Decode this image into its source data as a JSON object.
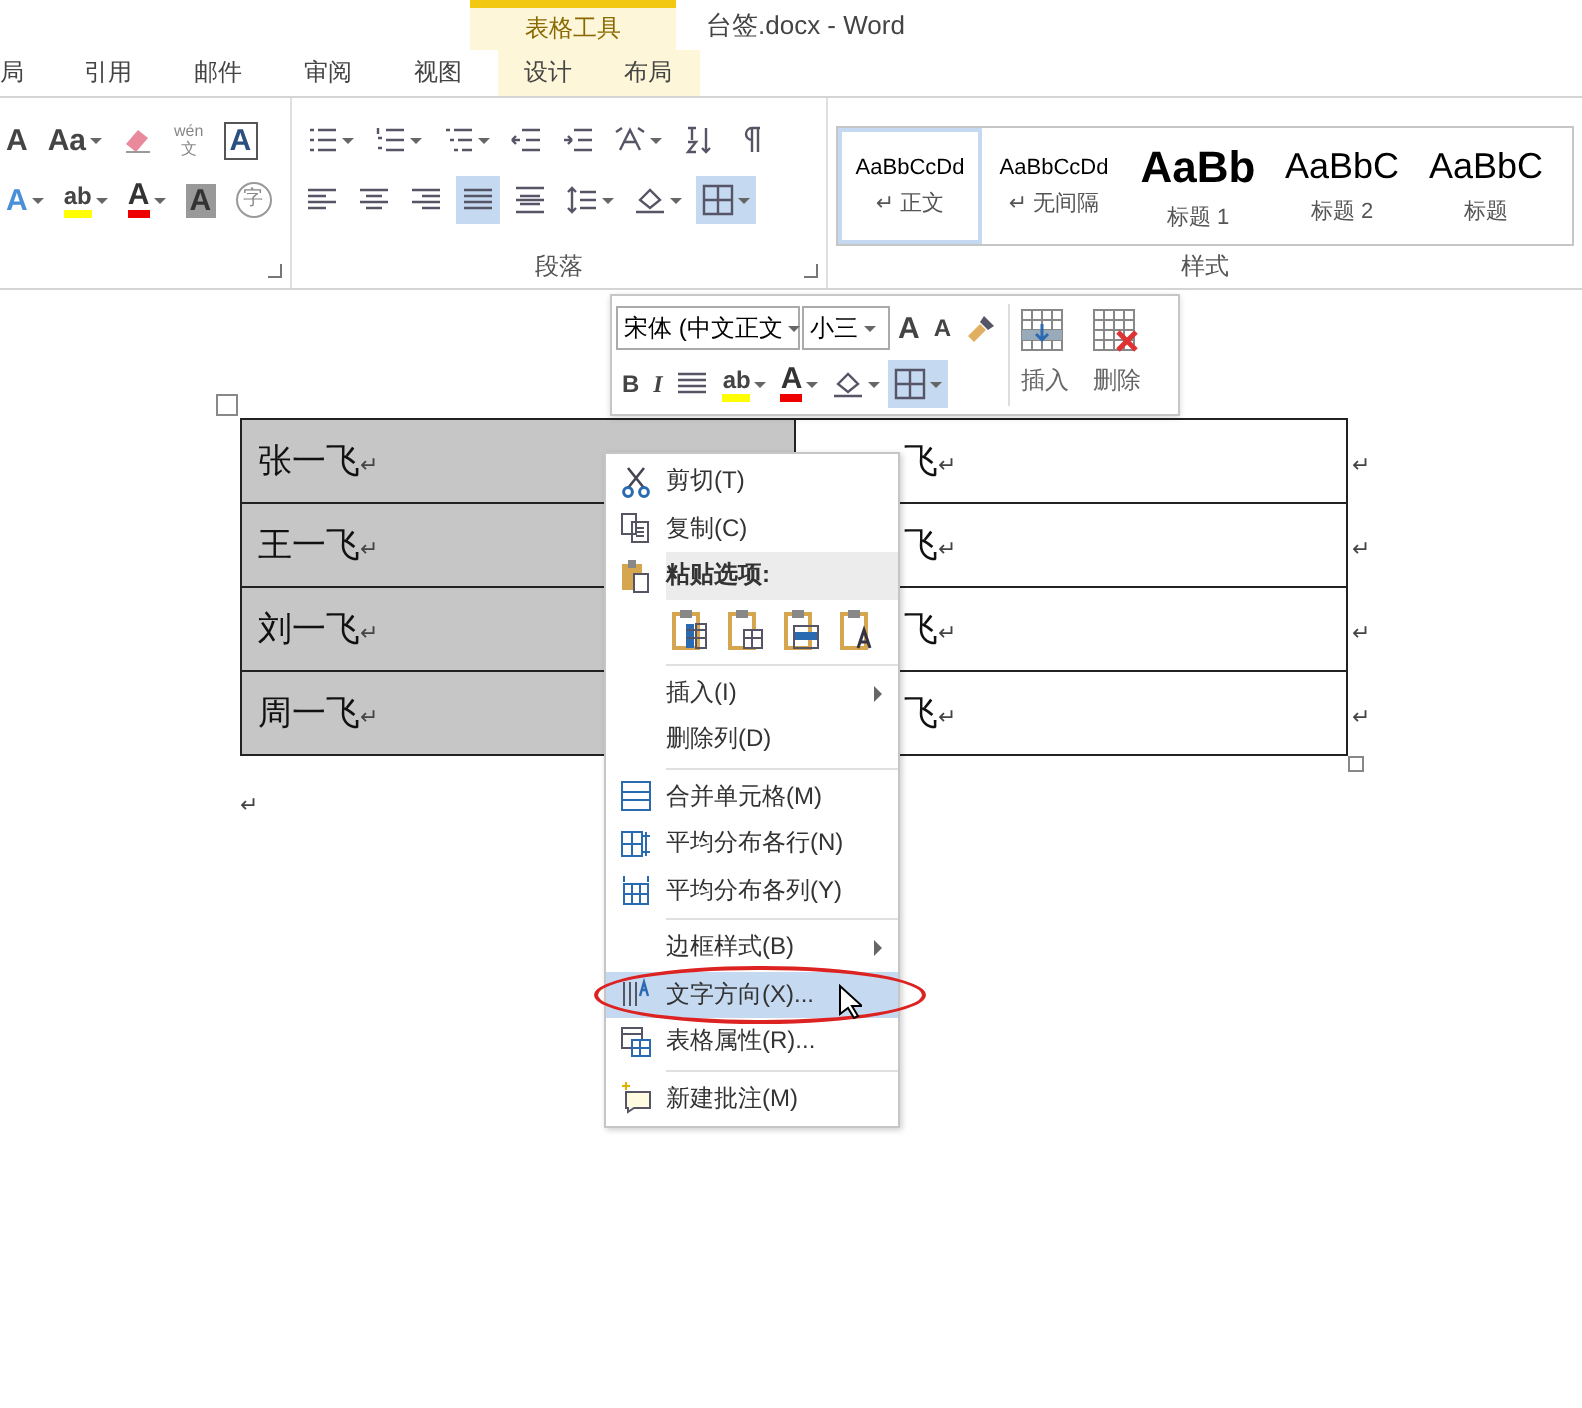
{
  "window": {
    "title": "台签.docx - Word",
    "context_tab_group": "表格工具"
  },
  "tabs": [
    {
      "label": "局",
      "selected": false,
      "contextual": false
    },
    {
      "label": "引用",
      "selected": false,
      "contextual": false
    },
    {
      "label": "邮件",
      "selected": false,
      "contextual": false
    },
    {
      "label": "审阅",
      "selected": false,
      "contextual": false
    },
    {
      "label": "视图",
      "selected": false,
      "contextual": false
    },
    {
      "label": "设计",
      "selected": false,
      "contextual": true
    },
    {
      "label": "布局",
      "selected": false,
      "contextual": true
    }
  ],
  "font_group": {
    "row1": [
      {
        "kind": "grow-font",
        "text": "A"
      },
      {
        "kind": "change-case",
        "text": "Aa"
      },
      {
        "kind": "clear-format"
      },
      {
        "kind": "phonetic",
        "text": "wén",
        "sub": "文"
      },
      {
        "kind": "char-border",
        "text": "A"
      }
    ],
    "row2": [
      {
        "kind": "text-effect",
        "text": "A"
      },
      {
        "kind": "highlight",
        "text": "ab"
      },
      {
        "kind": "font-color",
        "text": "A"
      },
      {
        "kind": "char-shading",
        "text": "A"
      },
      {
        "kind": "enclose",
        "text": "字"
      }
    ]
  },
  "paragraph_group": {
    "label": "段落",
    "row1": [
      {
        "kind": "bullets",
        "selected": false
      },
      {
        "kind": "numbering",
        "selected": false
      },
      {
        "kind": "multilevel",
        "selected": false
      },
      {
        "kind": "outdent",
        "selected": false
      },
      {
        "kind": "indent",
        "selected": false
      },
      {
        "kind": "asian-layout",
        "selected": false
      },
      {
        "kind": "sort",
        "selected": false
      },
      {
        "kind": "show-marks",
        "selected": false
      }
    ],
    "row2": [
      {
        "kind": "align-left",
        "selected": false
      },
      {
        "kind": "align-center",
        "selected": false
      },
      {
        "kind": "align-right",
        "selected": false
      },
      {
        "kind": "justify",
        "selected": true
      },
      {
        "kind": "distribute",
        "selected": false
      },
      {
        "kind": "line-spacing",
        "selected": false
      },
      {
        "kind": "shading",
        "selected": false
      },
      {
        "kind": "borders",
        "selected": true
      }
    ]
  },
  "styles_group": {
    "label": "样式",
    "styles": [
      {
        "sample": "AaBbCcDd",
        "name": "↵ 正文",
        "kind": "small",
        "selected": true
      },
      {
        "sample": "AaBbCcDd",
        "name": "↵ 无间隔",
        "kind": "small",
        "selected": false
      },
      {
        "sample": "AaBb",
        "name": "标题 1",
        "kind": "bold",
        "selected": false
      },
      {
        "sample": "AaBbC",
        "name": "标题 2",
        "kind": "large",
        "selected": false
      },
      {
        "sample": "AaBbC",
        "name": "标题",
        "kind": "large",
        "selected": false
      }
    ]
  },
  "mini_toolbar": {
    "font": "宋体 (中文正文",
    "size": "小三",
    "row1": [
      {
        "kind": "grow-font",
        "text": "A"
      },
      {
        "kind": "shrink-font",
        "text": "A"
      },
      {
        "kind": "format-painter"
      }
    ],
    "row2": [
      {
        "kind": "bold",
        "text": "B",
        "selected": false
      },
      {
        "kind": "italic",
        "text": "I",
        "selected": false
      },
      {
        "kind": "center",
        "selected": false
      },
      {
        "kind": "highlight",
        "text": "ab",
        "selected": false
      },
      {
        "kind": "font-color",
        "text": "A",
        "selected": false
      },
      {
        "kind": "shading",
        "selected": false
      },
      {
        "kind": "borders",
        "selected": true
      }
    ],
    "big": [
      {
        "kind": "insert-table",
        "label": "插入"
      },
      {
        "kind": "delete-table",
        "label": "删除"
      }
    ]
  },
  "table": {
    "end_mark": "↵",
    "rows": [
      {
        "cells": [
          {
            "text": "张一飞",
            "mark": "↵",
            "selected": true
          },
          {
            "text": "飞",
            "mark": "↵",
            "selected": false
          }
        ]
      },
      {
        "cells": [
          {
            "text": "王一飞",
            "mark": "↵",
            "selected": true
          },
          {
            "text": "飞",
            "mark": "↵",
            "selected": false
          }
        ]
      },
      {
        "cells": [
          {
            "text": "刘一飞",
            "mark": "↵",
            "selected": true
          },
          {
            "text": "飞",
            "mark": "↵",
            "selected": false
          }
        ]
      },
      {
        "cells": [
          {
            "text": "周一飞",
            "mark": "↵",
            "selected": true
          },
          {
            "text": "飞",
            "mark": "↵",
            "selected": false
          }
        ]
      }
    ]
  },
  "paragraph_mark": "↵",
  "context_menu": [
    {
      "kind": "cut",
      "label": "剪切(T)",
      "submenu": false,
      "selected": false,
      "circled": false
    },
    {
      "kind": "copy",
      "label": "复制(C)",
      "submenu": false,
      "selected": false,
      "circled": false
    },
    {
      "kind": "paste-header",
      "label": "粘贴选项:"
    },
    {
      "kind": "paste-options"
    },
    {
      "kind": "separator"
    },
    {
      "kind": "plain",
      "label": "插入(I)",
      "submenu": true,
      "selected": false,
      "circled": false
    },
    {
      "kind": "plain",
      "label": "删除列(D)",
      "submenu": false,
      "selected": false,
      "circled": false
    },
    {
      "kind": "separator"
    },
    {
      "kind": "merge",
      "label": "合并单元格(M)",
      "submenu": false,
      "selected": false,
      "circled": false
    },
    {
      "kind": "distribute-rows",
      "label": "平均分布各行(N)",
      "submenu": false,
      "selected": false,
      "circled": false
    },
    {
      "kind": "distribute-columns",
      "label": "平均分布各列(Y)",
      "submenu": false,
      "selected": false,
      "circled": false
    },
    {
      "kind": "separator"
    },
    {
      "kind": "plain",
      "label": "边框样式(B)",
      "submenu": true,
      "selected": false,
      "circled": false
    },
    {
      "kind": "text-direction",
      "label": "文字方向(X)...",
      "submenu": false,
      "selected": true,
      "circled": true
    },
    {
      "kind": "properties",
      "label": "表格属性(R)...",
      "submenu": false,
      "selected": false,
      "circled": false
    },
    {
      "kind": "separator"
    },
    {
      "kind": "comment",
      "label": "新建批注(M)",
      "submenu": false,
      "selected": false,
      "circled": false
    }
  ]
}
